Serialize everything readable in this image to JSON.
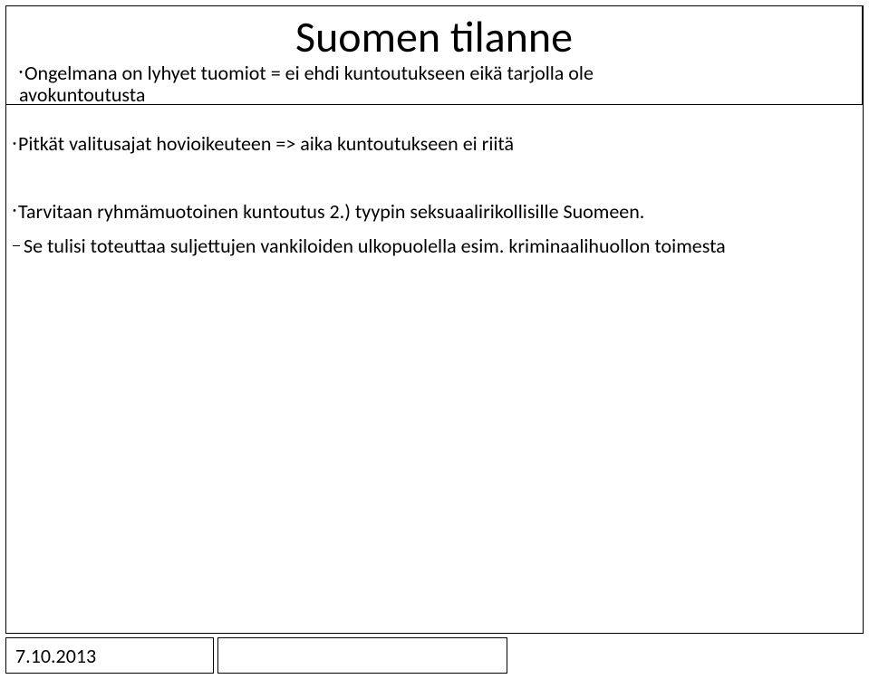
{
  "title": "Suomen tilanne",
  "title_sub1": "Ongelmana on lyhyet tuomiot = ei ehdi kuntoutukseen eikä tarjolla ole",
  "title_sub2": "avokuntoutusta",
  "bullets": {
    "b1": "Pitkät valitusajat hovioikeuteen => aika kuntoutukseen ei riitä",
    "b2": "Tarvitaan ryhmämuotoinen kuntoutus 2.) tyypin seksuaalirikollisille Suomeen.",
    "b3": "Se tulisi toteuttaa suljettujen vankiloiden ulkopuolella esim. kriminaalihuollon toimesta"
  },
  "date": "7.10.2013"
}
